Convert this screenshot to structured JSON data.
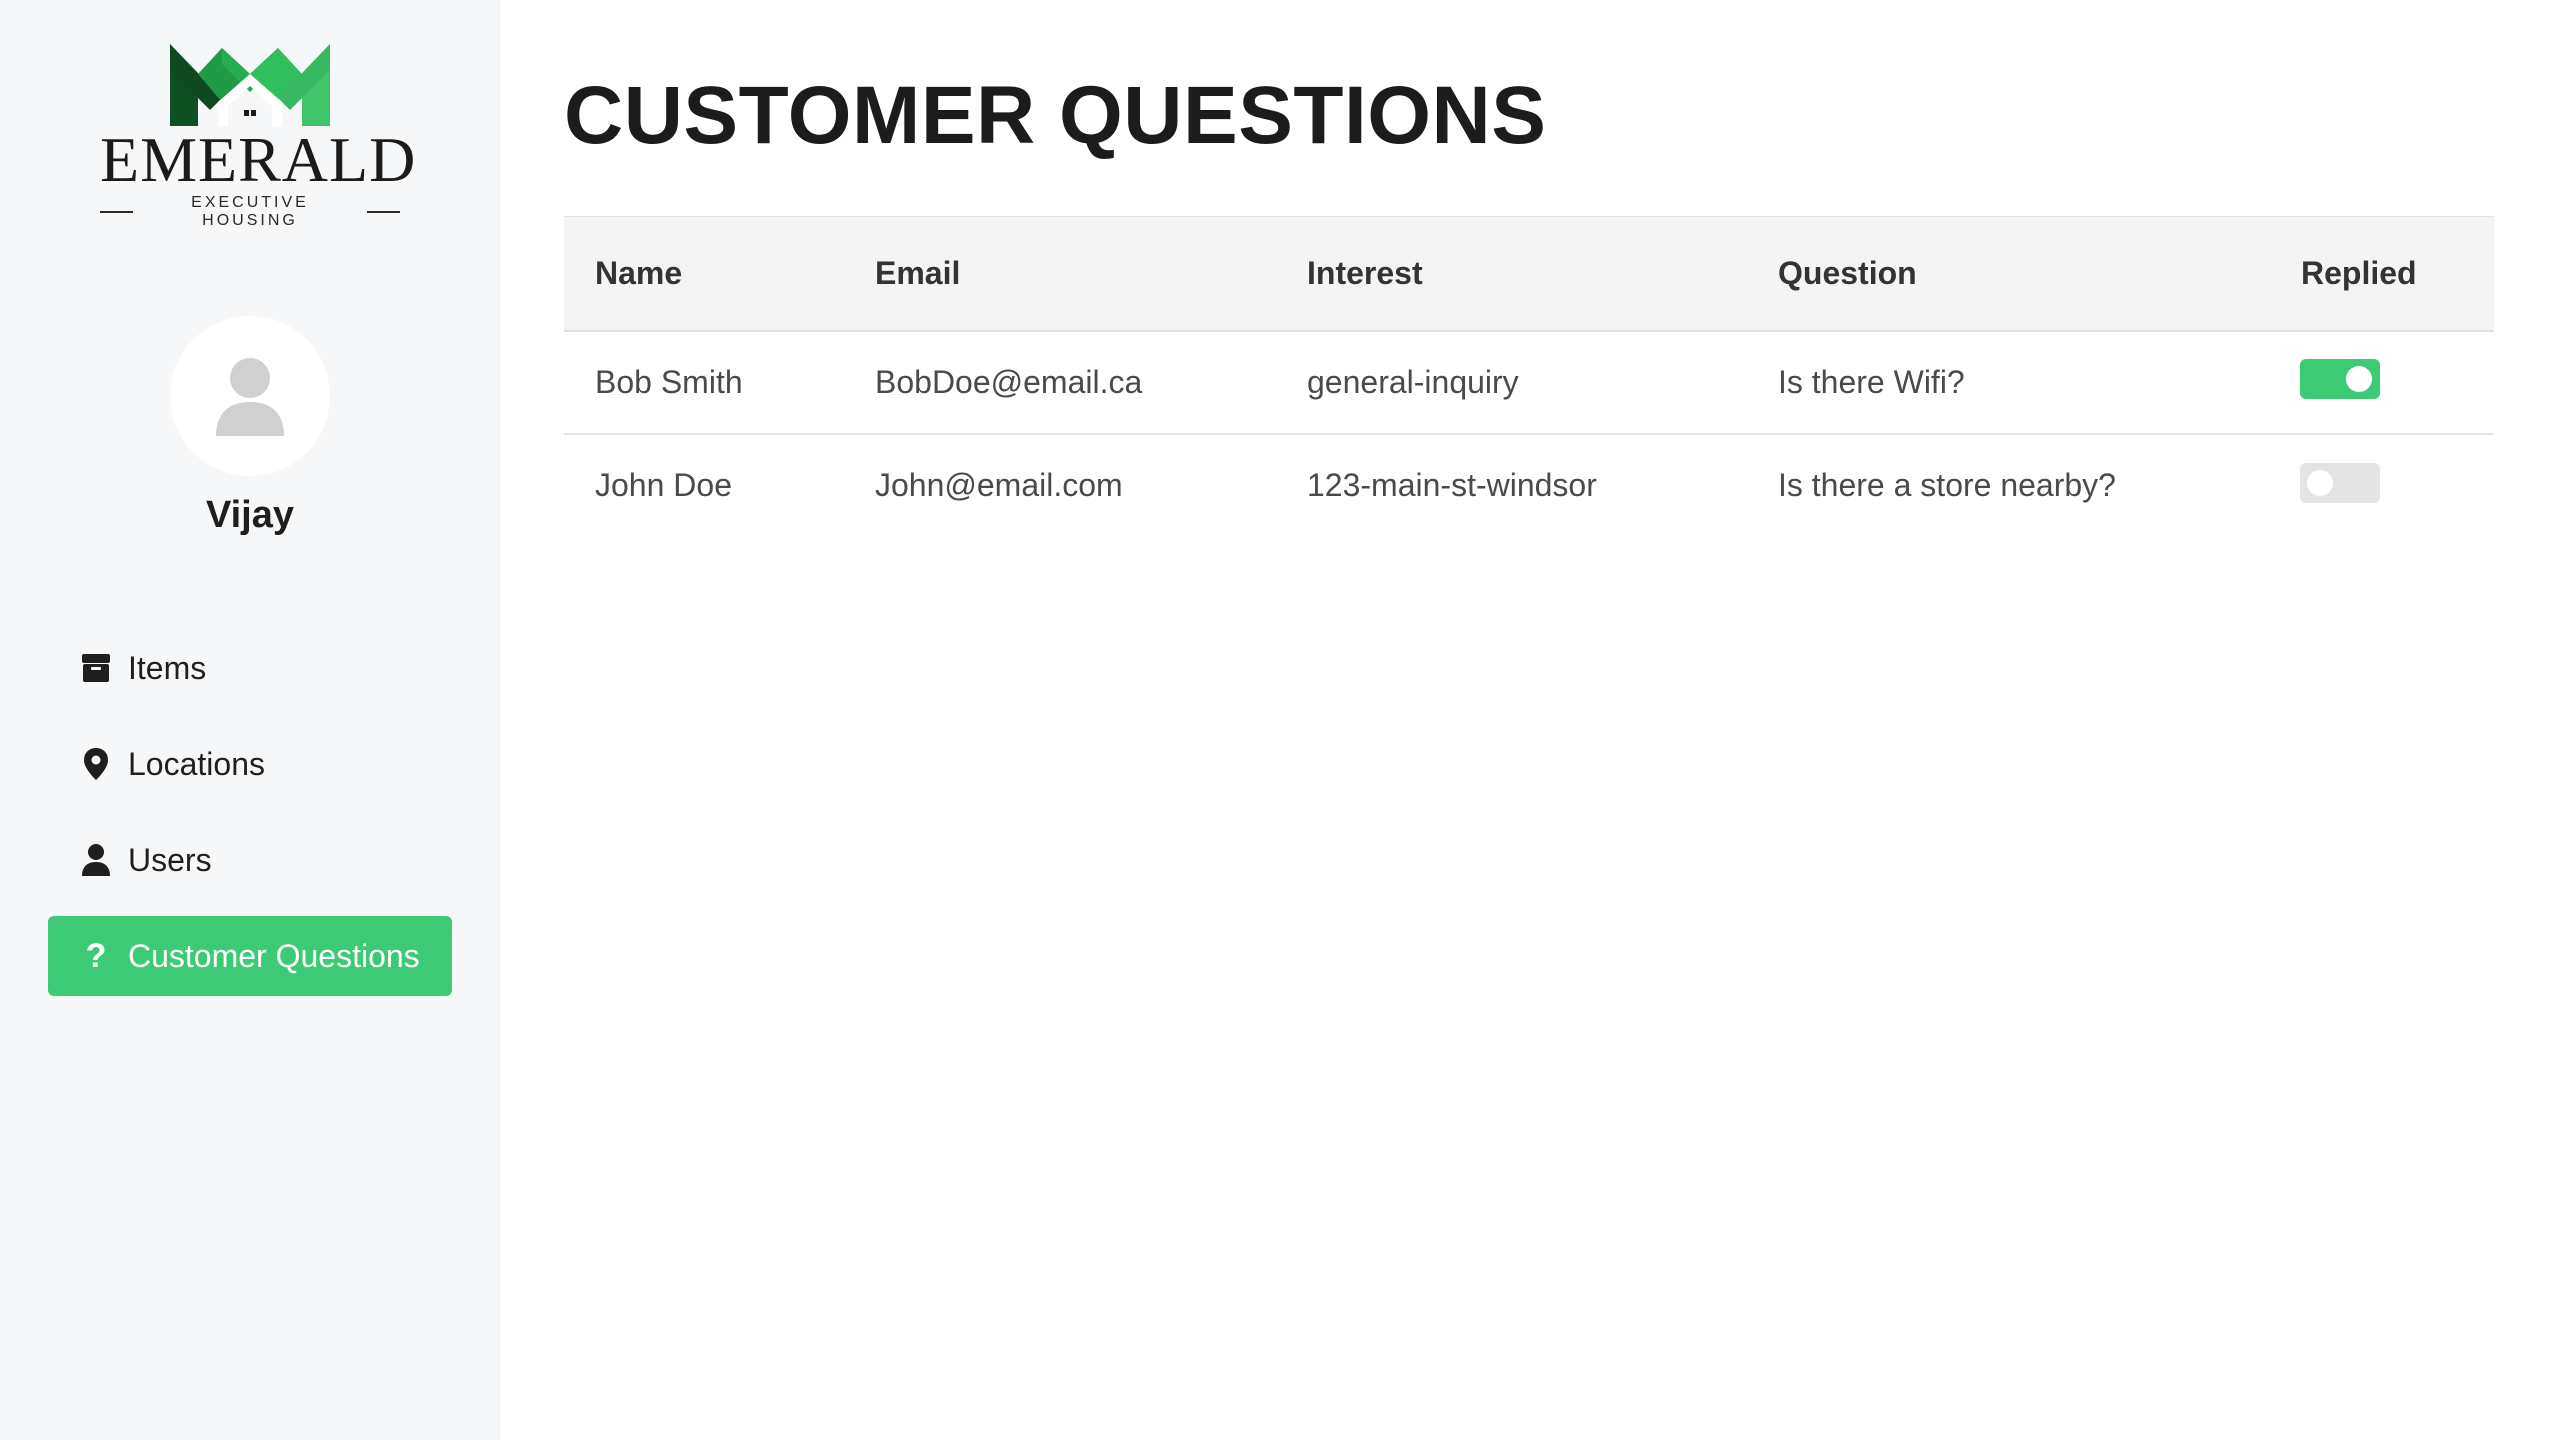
{
  "brand": {
    "name": "EMERALD",
    "tagline": "EXECUTIVE HOUSING",
    "colors": {
      "dark_green": "#0f5a2a",
      "green": "#27a84f",
      "light_green": "#3fc16a"
    }
  },
  "sidebar": {
    "username": "Vijay",
    "avatar_icon": "user-silhouette-icon",
    "items": [
      {
        "label": "Items",
        "icon": "box-icon",
        "active": false
      },
      {
        "label": "Locations",
        "icon": "map-pin-icon",
        "active": false
      },
      {
        "label": "Users",
        "icon": "user-icon",
        "active": false
      },
      {
        "label": "Customer Questions",
        "icon": "question-icon",
        "active": true
      }
    ]
  },
  "main": {
    "title": "CUSTOMER QUESTIONS",
    "table": {
      "columns": [
        "Name",
        "Email",
        "Interest",
        "Question",
        "Replied"
      ],
      "rows": [
        {
          "name": "Bob Smith",
          "email": "BobDoe@email.ca",
          "interest": "general-inquiry",
          "question": "Is there Wifi?",
          "replied": true
        },
        {
          "name": "John Doe",
          "email": "John@email.com",
          "interest": "123-main-st-windsor",
          "question": "Is there a store nearby?",
          "replied": false
        }
      ]
    }
  },
  "colors": {
    "accent": "#3ccb74",
    "sidebar_bg": "#f6f7f8",
    "header_bg": "#f3f4f3",
    "toggle_off": "#e4e4e4"
  }
}
